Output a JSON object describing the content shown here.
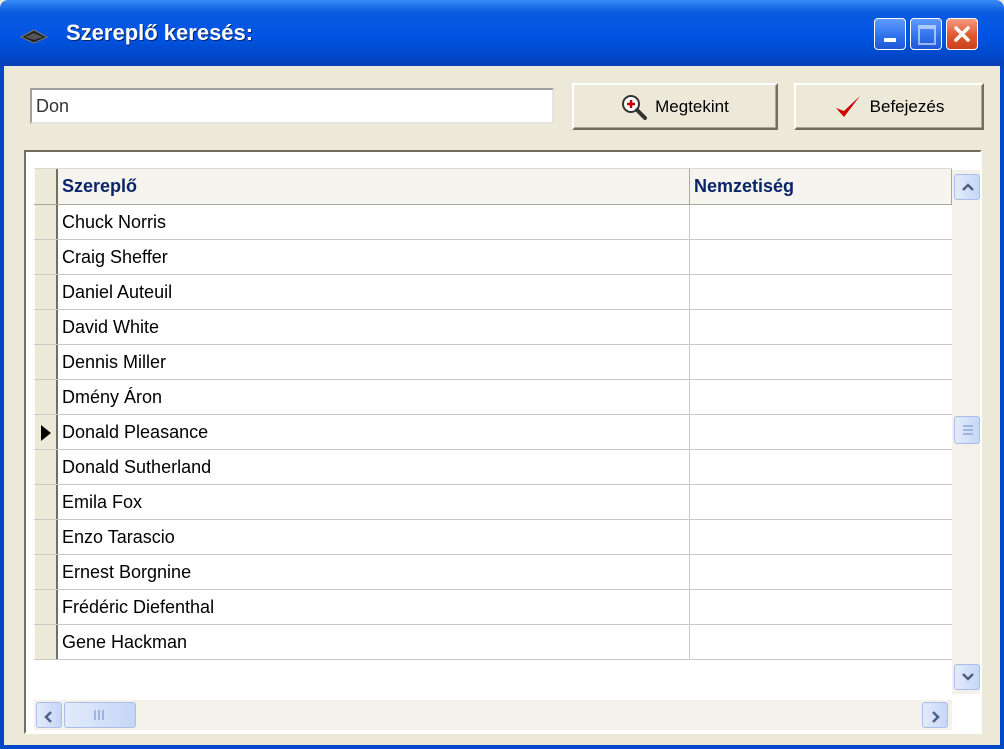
{
  "window": {
    "title": "Szereplő keresés:",
    "title_icon": "glasses-icon"
  },
  "search": {
    "value": "Don"
  },
  "buttons": {
    "view_label": "Megtekint",
    "view_icon": "magnifier-plus-icon",
    "done_label": "Befejezés",
    "done_icon": "red-checkmark-icon"
  },
  "grid": {
    "columns": [
      "Szereplő",
      "Nemzetiség"
    ],
    "rows": [
      {
        "actor": "Chuck Norris",
        "nationality": ""
      },
      {
        "actor": "Craig Sheffer",
        "nationality": ""
      },
      {
        "actor": "Daniel Auteuil",
        "nationality": ""
      },
      {
        "actor": "David White",
        "nationality": ""
      },
      {
        "actor": "Dennis Miller",
        "nationality": ""
      },
      {
        "actor": "Dmény Áron",
        "nationality": ""
      },
      {
        "actor": "Donald Pleasance",
        "nationality": "",
        "current": true
      },
      {
        "actor": "Donald Sutherland",
        "nationality": ""
      },
      {
        "actor": "Emila Fox",
        "nationality": ""
      },
      {
        "actor": "Enzo Tarascio",
        "nationality": ""
      },
      {
        "actor": "Ernest Borgnine",
        "nationality": ""
      },
      {
        "actor": "Frédéric Diefenthal",
        "nationality": ""
      },
      {
        "actor": "Gene Hackman",
        "nationality": ""
      }
    ]
  },
  "colors": {
    "titlebar": "#0054E3",
    "header_text": "#0A246A",
    "check": "#D00000"
  }
}
